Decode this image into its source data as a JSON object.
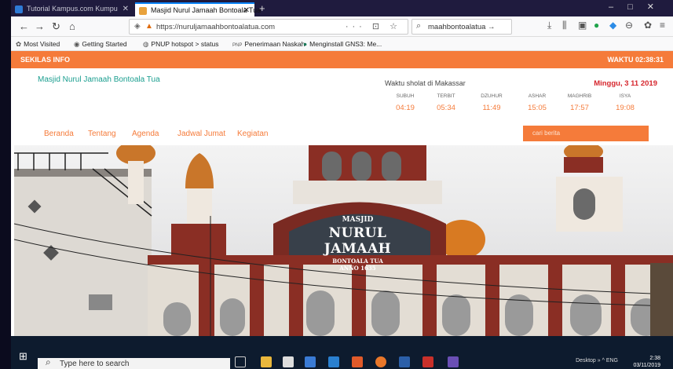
{
  "browser": {
    "tabs": [
      {
        "label": "Tutorial Kampus.com  Kumpu",
        "active": false
      },
      {
        "label": "Masjid Nurul Jamaah Bontoala Tua",
        "active": true
      }
    ],
    "url": "https://nuruljamaahbontoalatua.com",
    "url_actions": "··· ⊡ ☆",
    "search_value": "maahbontoalatua →",
    "bookmarks": [
      "Most Visited",
      "Getting Started",
      "PNUP hotspot > status",
      "Penerimaan Naskah",
      "Menginstall GNS3: Me..."
    ]
  },
  "site": {
    "info_label": "SEKILAS INFO",
    "clock_label": "WAKTU 02:38:31",
    "title": "Masjid Nurul Jamaah Bontoala Tua",
    "sholat_label": "Waktu sholat di Makassar",
    "date_label": "Minggu, 3 11 2019",
    "prayer_times": [
      {
        "name": "SUBUH",
        "time": "04:19"
      },
      {
        "name": "TERBIT",
        "time": "05:34"
      },
      {
        "name": "DZUHUR",
        "time": "11:49"
      },
      {
        "name": "ASHAR",
        "time": "15:05"
      },
      {
        "name": "MAGHRIB",
        "time": "17:57"
      },
      {
        "name": "ISYA",
        "time": "19:08"
      }
    ],
    "nav": [
      "Beranda",
      "Tentang",
      "Agenda",
      "Jadwal Jumat",
      "Kegiatan"
    ],
    "search_placeholder": "cari berita",
    "sign": {
      "line1": "MASJID",
      "line2": "NURUL JAMAAH",
      "line3": "BONTOALA TUA",
      "line4": "ANNO 1635"
    }
  },
  "taskbar": {
    "search_placeholder": "Type here to search",
    "tray_text": "Desktop  »  ^  ENG",
    "time": "2:38",
    "date": "03/11/2019"
  },
  "colors": {
    "accent": "#f57b3a",
    "teal": "#1a9e8f",
    "date_red": "#d6262d"
  }
}
